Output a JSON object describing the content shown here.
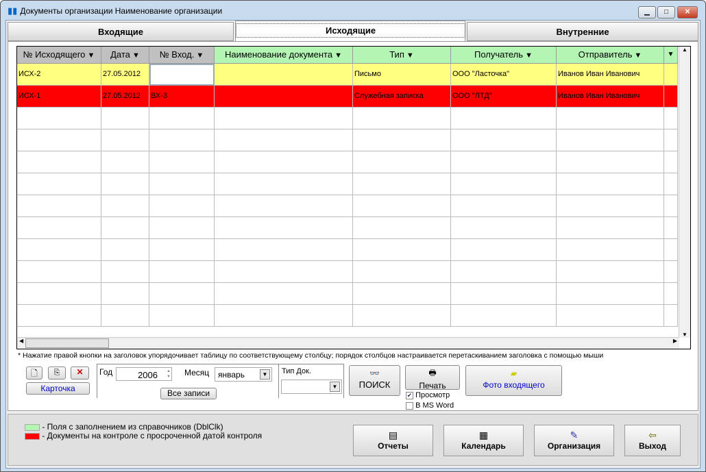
{
  "window": {
    "title": "Документы организации Наименование организации"
  },
  "tabs": [
    "Входящие",
    "Исходящие",
    "Внутренние"
  ],
  "table": {
    "columns": [
      "№ Исходящего",
      "Дата",
      "№ Вход.",
      "Наименование документа",
      "Тип",
      "Получатель",
      "Отправитель"
    ],
    "rows": [
      {
        "cells": [
          "ИСХ-2",
          "27.05.2012",
          "",
          "",
          "Письмо",
          "ООО \"Ласточка\"",
          "Иванов Иван Иванович"
        ],
        "color": "#ffff80"
      },
      {
        "cells": [
          "ИСХ-1",
          "27.05.2012",
          "ВХ-3",
          "",
          "Служебная записка",
          "ООО \"ЛТД\"",
          "Иванов Иван Иванович"
        ],
        "color": "#ff0000"
      }
    ]
  },
  "note": "* Нажатие правой кнопки на заголовок упорядочивает таблицу по соответствующему  столбцу;  порядок столбцов настраивается перетаскиванием заголовка с помощью мыши",
  "filters": {
    "card_label": "Карточка",
    "year_label": "Год",
    "year": "2006",
    "month_label": "Месяц",
    "month": "январь",
    "all_label": "Все записи",
    "doctype_label": "Тип Док.",
    "doctype": ""
  },
  "actions": {
    "search": "ПОИСК",
    "print": "Печать",
    "preview": "Просмотр",
    "msword": "В MS Word",
    "photo": "Фото входящего"
  },
  "legend": [
    {
      "text": "- Поля с заполнением из справочников (DblClk)",
      "color": "#b3f5b3"
    },
    {
      "text": "- Документы на контроле с просроченной датой контроля",
      "color": "#ff0000"
    }
  ],
  "buttons": {
    "reports": "Отчеты",
    "calendar": "Календарь",
    "org": "Организация",
    "exit": "Выход"
  }
}
